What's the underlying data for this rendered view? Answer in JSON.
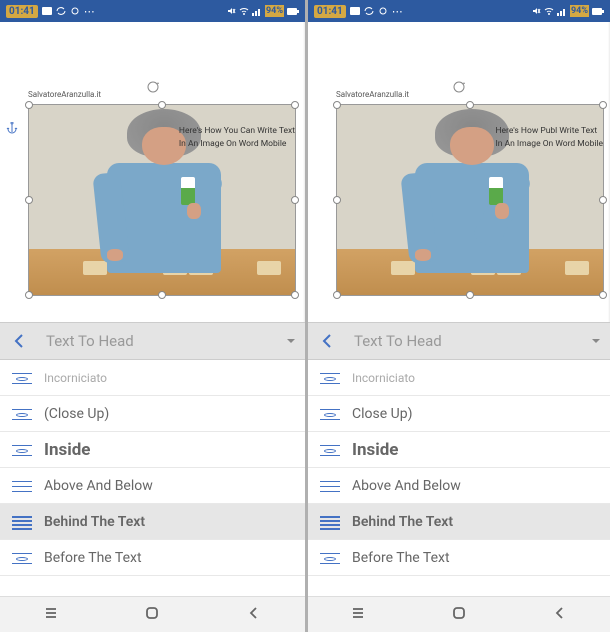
{
  "panes": [
    {
      "status": {
        "time": "01:41",
        "battery": "94%"
      },
      "watermark": "SalvatoreAranzulla.it",
      "overlay_line1": "Here's How You Can Write Text",
      "overlay_line2": "In An Image On Word Mobile",
      "toolbar": {
        "title": "Text To Head"
      },
      "options": [
        {
          "key": "incorniciato",
          "label": "Incorniciato",
          "style": "cut"
        },
        {
          "key": "closeup",
          "label": "(Close Up)",
          "style": "normal"
        },
        {
          "key": "inside",
          "label": "Inside",
          "style": "bold"
        },
        {
          "key": "aboveBelow",
          "label": "Above And Below",
          "style": "normal"
        },
        {
          "key": "behind",
          "label": "Behind The Text",
          "style": "selected"
        },
        {
          "key": "before",
          "label": "Before The Text",
          "style": "normal"
        }
      ]
    },
    {
      "status": {
        "time": "01:41",
        "battery": "94%"
      },
      "watermark": "SalvatoreAranzulla.it",
      "overlay_line1": "Here's How Publ Write Text",
      "overlay_line2": "In An Image On Word Mobile",
      "toolbar": {
        "title": "Text To Head"
      },
      "options": [
        {
          "key": "incorniciato",
          "label": "Incorniciato",
          "style": "cut"
        },
        {
          "key": "closeup",
          "label": "Close Up)",
          "style": "normal"
        },
        {
          "key": "inside",
          "label": "Inside",
          "style": "bold"
        },
        {
          "key": "aboveBelow",
          "label": "Above And Below",
          "style": "normal"
        },
        {
          "key": "behind",
          "label": "Behind The Text",
          "style": "selected"
        },
        {
          "key": "before",
          "label": "Before The Text",
          "style": "normal"
        }
      ]
    }
  ]
}
